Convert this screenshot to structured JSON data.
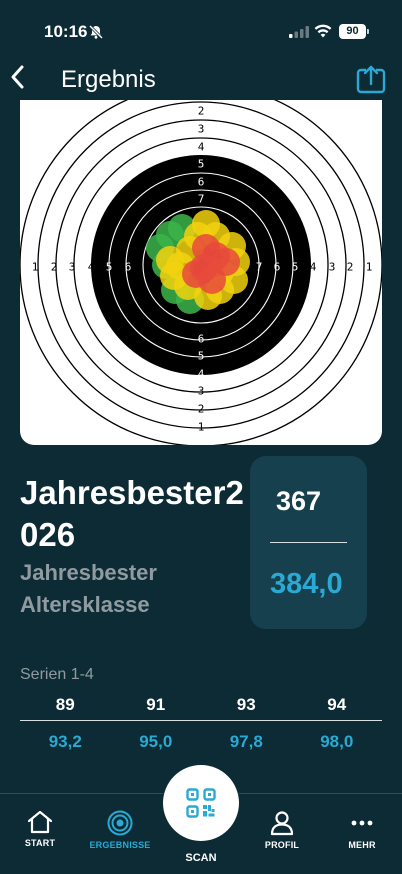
{
  "status": {
    "time": "10:16",
    "battery": "90"
  },
  "nav": {
    "title": "Ergebnis",
    "back_icon": "chevron-left-icon",
    "share_icon": "share-icon"
  },
  "target": {
    "vertical_ring_numbers_top": [
      "2",
      "3",
      "4",
      "5",
      "6",
      "7"
    ],
    "vertical_ring_numbers_bottom": [
      "6",
      "5",
      "4",
      "3",
      "2",
      "1"
    ],
    "horizontal_ring_numbers_left": [
      "1",
      "2",
      "3",
      "4",
      "5",
      "6"
    ],
    "horizontal_ring_numbers_right": [
      "7",
      "6",
      "5",
      "4",
      "3",
      "2",
      "1"
    ],
    "colors": {
      "black": "#000000",
      "green": "#3cb54a",
      "yellow": "#f2d20f",
      "red": "#e84a3c"
    }
  },
  "result": {
    "name": "Jahresbester2026",
    "category": "Jahresbester Altersklasse",
    "score_integer": "367",
    "score_decimal": "384,0"
  },
  "series": {
    "label": "Serien 1-4",
    "integer_scores": [
      "89",
      "91",
      "93",
      "94"
    ],
    "decimal_scores": [
      "93,2",
      "95,0",
      "97,8",
      "98,0"
    ]
  },
  "tabs": [
    {
      "label": "START",
      "icon": "home-icon",
      "active": false
    },
    {
      "label": "ERGEBNISSE",
      "icon": "target-icon",
      "active": true
    },
    {
      "label": "SCAN",
      "icon": "qr-code-icon",
      "active": false
    },
    {
      "label": "PROFIL",
      "icon": "person-icon",
      "active": false
    },
    {
      "label": "MEHR",
      "icon": "more-dots-icon",
      "active": false
    }
  ],
  "accent_color": "#29a9d3"
}
